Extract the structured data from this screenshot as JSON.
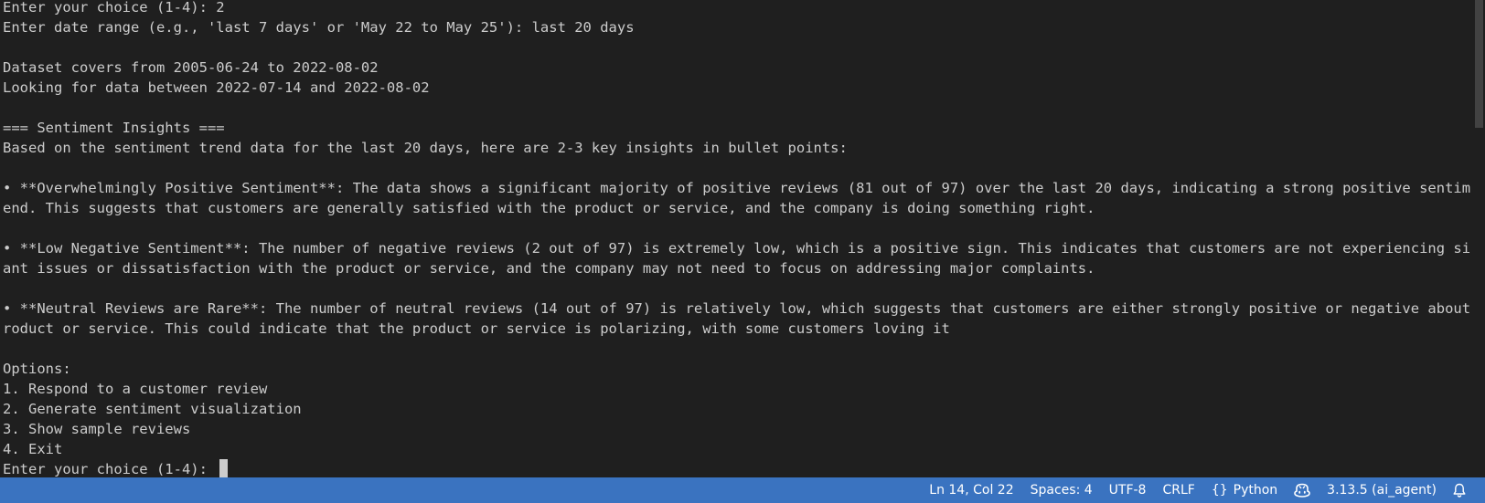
{
  "terminal": {
    "lines": [
      "Enter your choice (1-4): 2",
      "Enter date range (e.g., 'last 7 days' or 'May 22 to May 25'): last 20 days",
      "",
      "Dataset covers from 2005-06-24 to 2022-08-02",
      "Looking for data between 2022-07-14 and 2022-08-02",
      "",
      "=== Sentiment Insights ===",
      "Based on the sentiment trend data for the last 20 days, here are 2-3 key insights in bullet points:",
      "",
      "• **Overwhelmingly Positive Sentiment**: The data shows a significant majority of positive reviews (81 out of 97) over the last 20 days, indicating a strong positive sentiment tr",
      "end. This suggests that customers are generally satisfied with the product or service, and the company is doing something right.",
      "",
      "• **Low Negative Sentiment**: The number of negative reviews (2 out of 97) is extremely low, which is a positive sign. This indicates that customers are not experiencing signific",
      "ant issues or dissatisfaction with the product or service, and the company may not need to focus on addressing major complaints.",
      "",
      "• **Neutral Reviews are Rare**: The number of neutral reviews (14 out of 97) is relatively low, which suggests that customers are either strongly positive or negative about the p",
      "roduct or service. This could indicate that the product or service is polarizing, with some customers loving it",
      "",
      "Options:",
      "1. Respond to a customer review",
      "2. Generate sentiment visualization",
      "3. Show sample reviews",
      "4. Exit"
    ],
    "prompt": "Enter your choice (1-4): "
  },
  "statusbar": {
    "position": "Ln 14, Col 22",
    "spaces": "Spaces: 4",
    "encoding": "UTF-8",
    "eol": "CRLF",
    "language_icon": "{}",
    "language": "Python",
    "copilot_icon": "copilot-icon",
    "interpreter": "3.13.5 (ai_agent)",
    "bell_icon": "bell-icon",
    "bg_color": "#3a73c0"
  }
}
